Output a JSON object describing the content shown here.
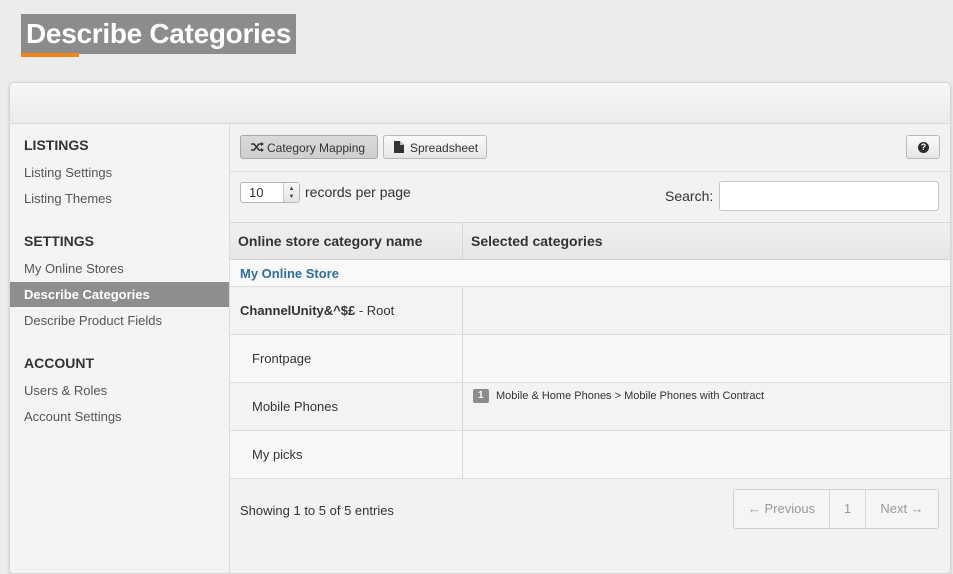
{
  "page": {
    "title": "Describe Categories"
  },
  "colors": {
    "accent": "#f0851a",
    "link": "#2f6e9c",
    "active_nav": "#8e8e8e"
  },
  "sidebar": {
    "sections": [
      {
        "heading": "LISTINGS",
        "items": [
          {
            "label": "Listing Settings"
          },
          {
            "label": "Listing Themes"
          }
        ]
      },
      {
        "heading": "SETTINGS",
        "items": [
          {
            "label": "My Online Stores"
          },
          {
            "label": "Describe Categories",
            "active": true
          },
          {
            "label": "Describe Product Fields"
          }
        ]
      },
      {
        "heading": "ACCOUNT",
        "items": [
          {
            "label": "Users & Roles"
          },
          {
            "label": "Account Settings"
          }
        ]
      }
    ]
  },
  "toolbar": {
    "category_mapping_label": "Category Mapping",
    "category_mapping_icon": "shuffle-icon",
    "spreadsheet_label": "Spreadsheet",
    "spreadsheet_icon": "document-icon",
    "help_label": "?"
  },
  "controls": {
    "page_size": "10",
    "records_per_page_label": "records per page",
    "search_label": "Search:",
    "search_value": ""
  },
  "table": {
    "columns": [
      "Online store category name",
      "Selected categories"
    ],
    "group": "My Online Store",
    "rows": [
      {
        "name_bold": "ChannelUnity&^$£",
        "name_rest": " - Root",
        "indent": false,
        "badge": "",
        "category": ""
      },
      {
        "name_bold": "",
        "name_rest": "Frontpage",
        "indent": true,
        "badge": "",
        "category": ""
      },
      {
        "name_bold": "",
        "name_rest": "Mobile Phones",
        "indent": true,
        "badge": "1",
        "category": "Mobile & Home Phones > Mobile Phones with Contract"
      },
      {
        "name_bold": "",
        "name_rest": "My picks",
        "indent": true,
        "badge": "",
        "category": ""
      }
    ]
  },
  "footer": {
    "info": "Showing 1 to 5 of 5 entries",
    "previous_label": "← Previous",
    "current_page": "1",
    "next_label": "Next →"
  }
}
